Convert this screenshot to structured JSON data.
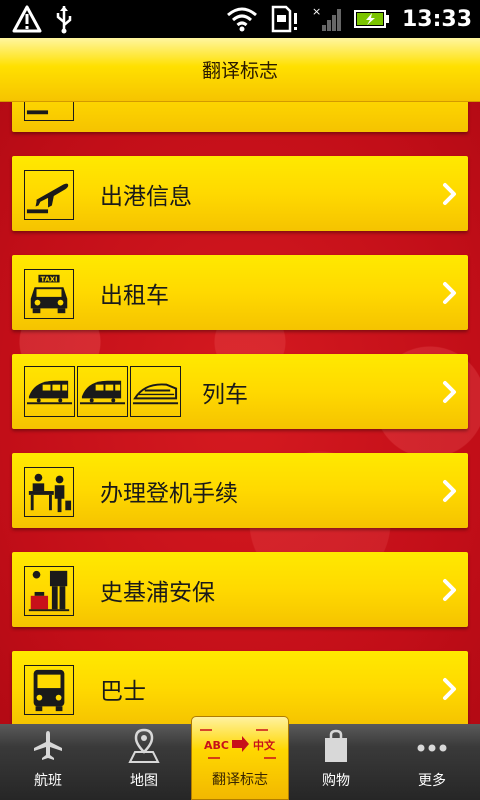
{
  "status_bar": {
    "time": "13:33"
  },
  "header": {
    "title": "翻译标志"
  },
  "items": [
    {
      "label": "出港信息",
      "icon": "departure-plane-icon"
    },
    {
      "label": "出租车",
      "icon": "taxi-icon"
    },
    {
      "label": "列车",
      "icons": [
        "train-icon",
        "train-icon",
        "high-speed-train-icon"
      ]
    },
    {
      "label": "办理登机手续",
      "icon": "check-in-counter-icon"
    },
    {
      "label": "史基浦安保",
      "icon": "security-icon"
    },
    {
      "label": "巴士",
      "icon": "bus-icon"
    }
  ],
  "bottom_nav": [
    {
      "label": "航班",
      "icon": "plane-icon"
    },
    {
      "label": "地图",
      "icon": "map-pin-icon"
    },
    {
      "label": "翻译标志",
      "icon": "translate-signs-icon",
      "icon_text_left": "ABC",
      "icon_text_right": "中文",
      "active": true
    },
    {
      "label": "购物",
      "icon": "shopping-bag-icon"
    },
    {
      "label": "更多",
      "icon": "more-dots-icon"
    }
  ],
  "colors": {
    "accent_yellow": "#ffd900",
    "background_red": "#c8101a",
    "active_tab_text": "#c8101a"
  }
}
